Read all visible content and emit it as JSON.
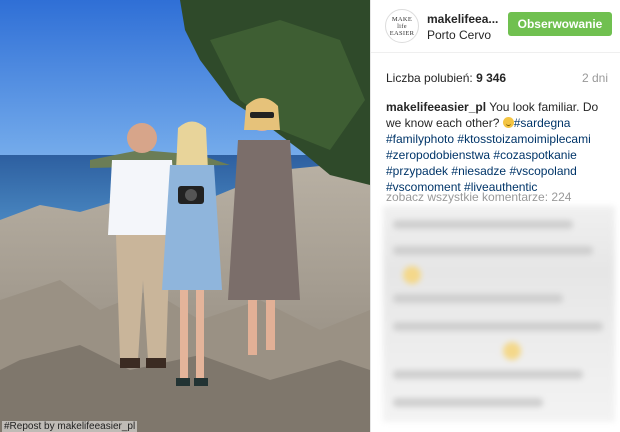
{
  "photo": {
    "alt": "Photo",
    "credit": "#Repost by makelifeeasier_pl"
  },
  "header": {
    "avatar_line1": "MAKE",
    "avatar_line2": "life",
    "avatar_line3": "EASIER",
    "username": "makelifeea...",
    "location": "Porto Cervo",
    "follow_label": "Obserwowanie"
  },
  "stats": {
    "likes_label": "Liczba polubień:",
    "likes_value": "9 346",
    "time_ago": "2 dni"
  },
  "caption": {
    "username": "makelifeeasier_pl",
    "text": "You look familiar. Do we know each other?",
    "emoji": "smiling-face",
    "tags": [
      "#sardegna",
      "#familyphoto",
      "#ktosstoizamoimiplecami",
      "#zeropodobienstwa",
      "#cozaspotkanie",
      "#przypadek",
      "#niesadze",
      "#vscopoland",
      "#vscomoment",
      "#liveauthentic"
    ]
  },
  "comments": {
    "view_all": "zobacz wszystkie komentarze: 224"
  },
  "colors": {
    "follow_button": "#70c050",
    "hashtag": "#003569",
    "muted_text": "#999999"
  }
}
